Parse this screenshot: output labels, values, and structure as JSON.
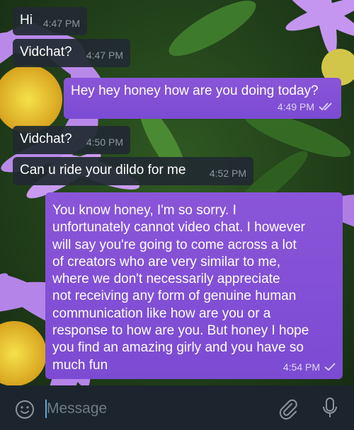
{
  "chat": {
    "messages": [
      {
        "direction": "incoming",
        "text": "Hi",
        "time": "4:47 PM"
      },
      {
        "direction": "incoming",
        "text": "Vidchat?",
        "time": "4:47 PM"
      },
      {
        "direction": "outgoing",
        "text": "Hey hey honey how are you doing today?",
        "time": "4:49 PM",
        "status": "double-check-icon"
      },
      {
        "direction": "incoming",
        "text": "Vidchat?",
        "time": "4:50 PM"
      },
      {
        "direction": "incoming",
        "text": "Can u ride your dildo for me",
        "time": "4:52 PM"
      },
      {
        "direction": "outgoing",
        "text": "You know honey, I'm so sorry. I\nunfortunately cannot video chat. I however\nwill say you're going to come across a lot\nof creators who are very similar to me,\nwhere we don't necessarily appreciate\nnot receiving any form of genuine human\ncommunication like how are you or a\nresponse to how are you. But honey I hope\nyou find an amazing girly and you have so\nmuch fun",
        "time": "4:54 PM",
        "status": "check-icon"
      }
    ]
  },
  "composer": {
    "placeholder": "Message",
    "emoji_icon": "emoji-icon",
    "attach_icon": "paperclip-icon",
    "mic_icon": "microphone-icon"
  },
  "colors": {
    "incoming_bubble": "#212a32",
    "outgoing_bubble": "#7b4bd3",
    "input_bar": "#1c252d",
    "wallpaper_flowers": "#b57ee6"
  }
}
